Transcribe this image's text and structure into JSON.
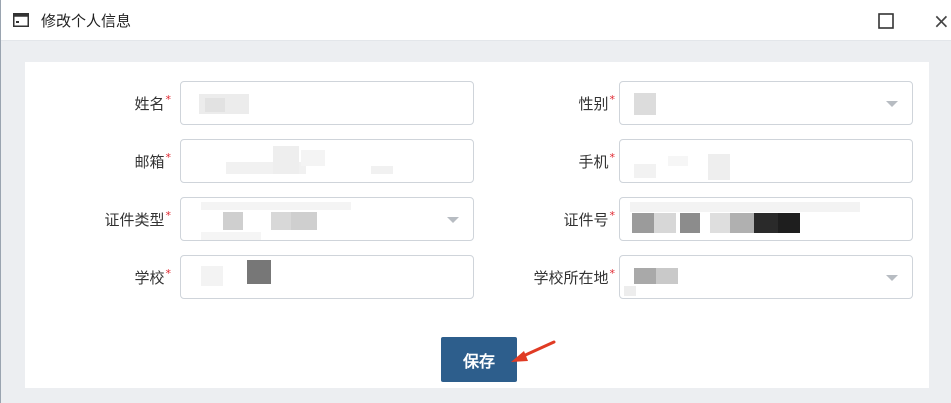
{
  "window": {
    "title": "修改个人信息",
    "maximize_icon": "maximize-icon",
    "close_label": "×"
  },
  "form": {
    "required_mark": "*",
    "fields": {
      "name": {
        "label": "姓名",
        "type": "text"
      },
      "gender": {
        "label": "性别",
        "type": "select"
      },
      "email": {
        "label": "邮箱",
        "type": "text"
      },
      "phone": {
        "label": "手机",
        "type": "text"
      },
      "id_type": {
        "label": "证件类型",
        "type": "select"
      },
      "id_number": {
        "label": "证件号",
        "type": "text"
      },
      "school": {
        "label": "学校",
        "type": "text"
      },
      "school_location": {
        "label": "学校所在地",
        "type": "select"
      }
    },
    "save_label": "保存"
  },
  "colors": {
    "accent": "#2d5e8c",
    "required": "#e0262f",
    "annotation_arrow": "#e03b24",
    "field_border": "#cfd4da",
    "background": "#eceef1"
  }
}
